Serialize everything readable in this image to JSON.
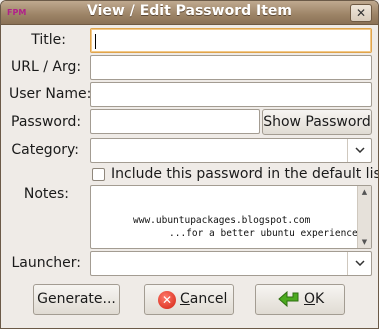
{
  "window": {
    "title": "View / Edit Password Item",
    "app_icon_text": "FPM",
    "close_glyph": "✕"
  },
  "form": {
    "title_label": "Title:",
    "title_value": "",
    "url_label": "URL / Arg:",
    "url_value": "",
    "user_label": "User Name:",
    "user_value": "",
    "password_label": "Password:",
    "password_value": "",
    "show_password_label": "Show Password",
    "category_label": "Category:",
    "category_value": "",
    "include_default_label": "Include this password in the default list.",
    "include_default_checked": false,
    "notes_label": "Notes:",
    "notes_line1": "www.ubuntupackages.blogspot.com",
    "notes_line2": "...for a better ubuntu experience",
    "launcher_label": "Launcher:",
    "launcher_value": ""
  },
  "buttons": {
    "generate_label": "Generate...",
    "cancel_label": "Cancel",
    "cancel_mnemonic": "C",
    "ok_label": "OK",
    "ok_mnemonic": "O"
  },
  "icons": {
    "close": "close-icon",
    "combo": "chevron-down-icon",
    "cancel": "cancel-icon",
    "ok": "ok-arrow-icon"
  },
  "colors": {
    "titlebar": "#9c8366",
    "focus_border": "#e0a44b",
    "cancel_red": "#d21f10",
    "ok_green": "#4caa1f"
  }
}
